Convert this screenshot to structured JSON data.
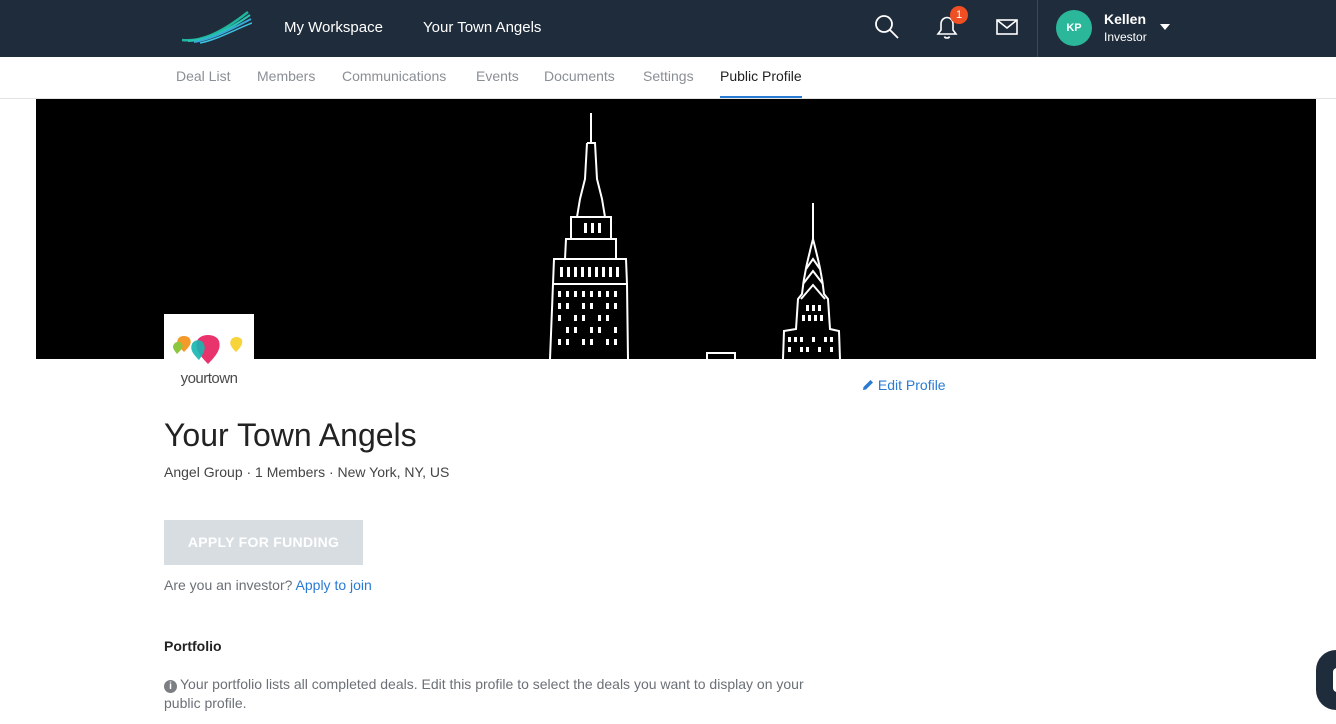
{
  "header": {
    "nav": [
      "My Workspace",
      "Your Town Angels"
    ],
    "notification_count": "1",
    "user": {
      "initials": "KP",
      "name": "Kellen",
      "role": "Investor"
    },
    "icons": [
      "logo-icon",
      "search-icon",
      "bell-icon",
      "mail-icon",
      "chevron-down-icon"
    ]
  },
  "tabs": [
    "Deal List",
    "Members",
    "Communications",
    "Events",
    "Documents",
    "Settings",
    "Public Profile"
  ],
  "active_tab": "Public Profile",
  "profile": {
    "logo_text": "yourtown",
    "edit_label": "Edit Profile",
    "name": "Your Town Angels",
    "meta": "Angel Group · 1 Members · New York, NY, US",
    "apply_button": "APPLY FOR FUNDING",
    "investor_prompt": "Are you an investor?",
    "investor_link": "Apply to join",
    "portfolio_heading": "Portfolio",
    "portfolio_info": "Your portfolio lists all completed deals. Edit this profile to select the deals you want to display on your public profile."
  },
  "colors": {
    "topbar": "#1f2c3b",
    "accent": "#2a7bd3",
    "avatar": "#2bb89a",
    "badge": "#f04e23",
    "logo_pin_red": "#e8336d",
    "logo_pin_teal": "#16b6b1",
    "logo_pin_yellow": "#f6d43a",
    "logo_pin_green": "#8dc63f",
    "logo_pin_orange": "#f39a2a"
  }
}
